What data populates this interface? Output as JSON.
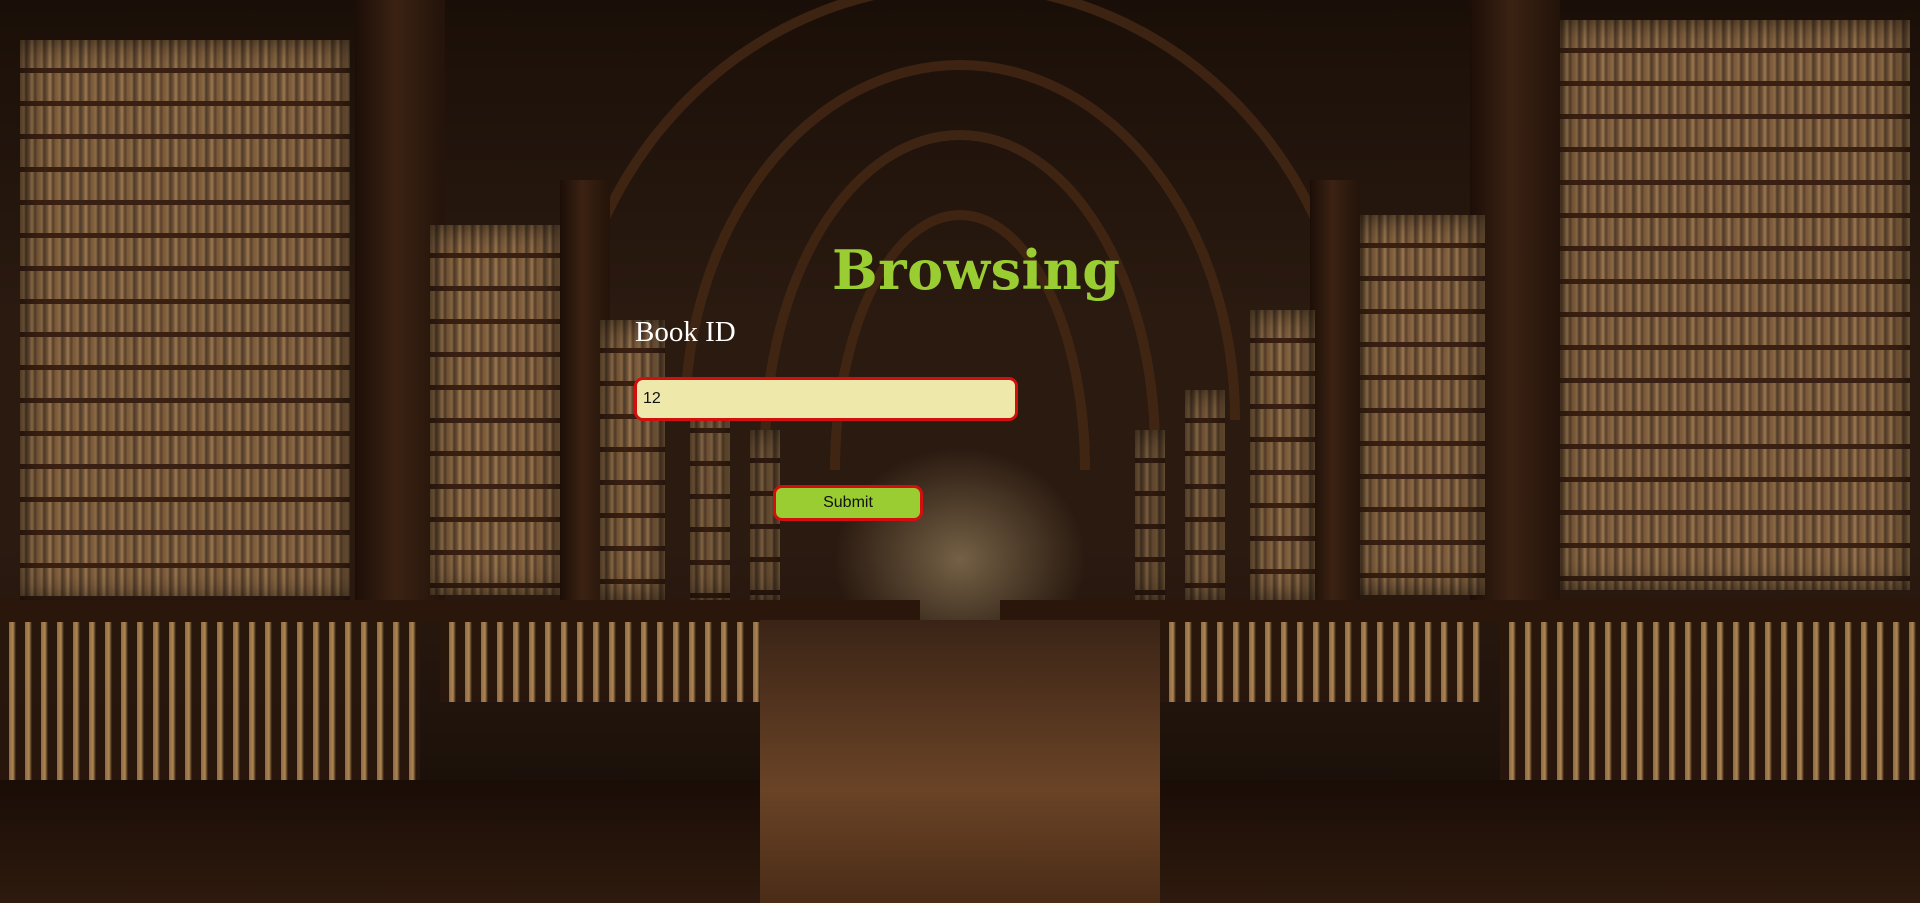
{
  "page": {
    "title": "Browsing",
    "background_image": "library-interior"
  },
  "form": {
    "book_id_label": "Book ID",
    "book_id_value": "12",
    "submit_label": "Submit"
  },
  "colors": {
    "title": "#9acd32",
    "label": "#ffffff",
    "input_background": "#eee8aa",
    "input_border": "#d10f0f",
    "button_background": "#9acd32",
    "button_border": "#d10f0f"
  }
}
